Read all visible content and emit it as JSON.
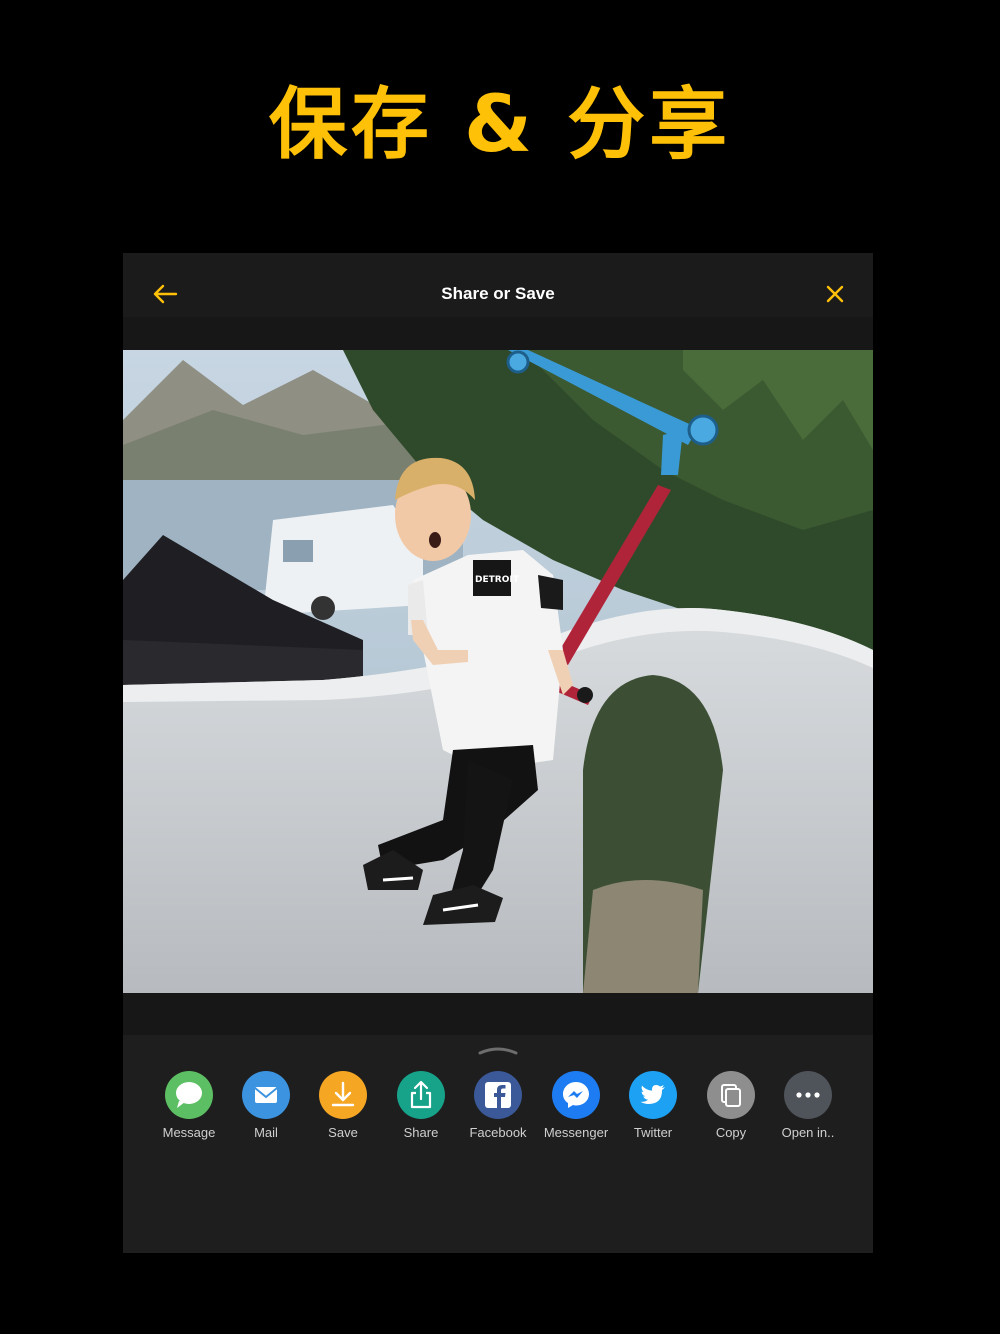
{
  "promo": {
    "title": "保存 & 分享"
  },
  "nav": {
    "title": "Share or Save",
    "back_icon": "arrow-left-icon",
    "close_icon": "close-icon",
    "accent_color": "#FFC107"
  },
  "photo": {
    "description_icon": "photo-preview",
    "shirt_text": "DETROIT"
  },
  "share_sheet": {
    "items": [
      {
        "label": "Message",
        "icon": "message-icon",
        "color": "#5DBF63"
      },
      {
        "label": "Mail",
        "icon": "mail-icon",
        "color": "#3C93E0"
      },
      {
        "label": "Save",
        "icon": "download-icon",
        "color": "#F5A623"
      },
      {
        "label": "Share",
        "icon": "share-icon",
        "color": "#17A28A"
      },
      {
        "label": "Facebook",
        "icon": "facebook-icon",
        "color": "#3B5998"
      },
      {
        "label": "Messenger",
        "icon": "messenger-icon",
        "color": "#1E7CF2"
      },
      {
        "label": "Twitter",
        "icon": "twitter-icon",
        "color": "#1DA1F2"
      },
      {
        "label": "Copy",
        "icon": "copy-icon",
        "color": "#8E8E8E"
      },
      {
        "label": "Open in..",
        "icon": "more-icon",
        "color": "#4F535A"
      }
    ]
  }
}
